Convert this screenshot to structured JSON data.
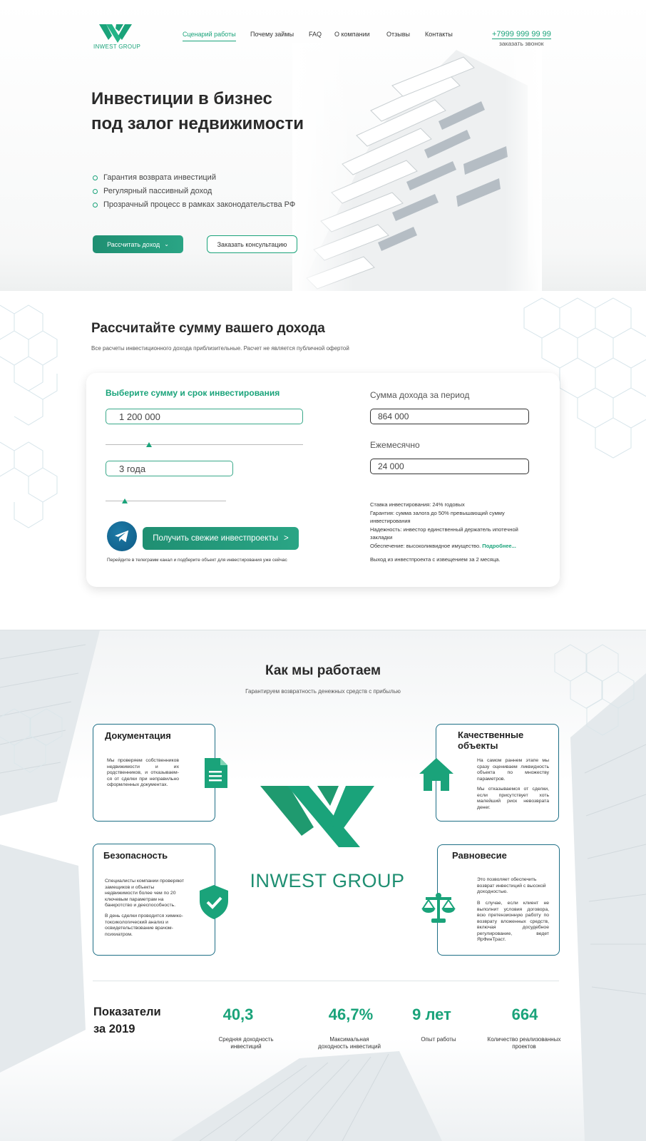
{
  "brand": {
    "name": "INWEST GROUP",
    "accent": "#1aa37a"
  },
  "nav": {
    "items": [
      "Сценарий работы",
      "Почему займы",
      "FAQ",
      "О компании",
      "Отзывы",
      "Контакты"
    ],
    "active": "Сценарий работы"
  },
  "contact": {
    "phone": "+7999 999 99 99",
    "callback": "заказать звонок"
  },
  "hero": {
    "title_line1": "Инвестиции в бизнес",
    "title_line2": "под залог недвижимости",
    "bullets": [
      "Гарантия возврата инвестиций",
      "Регулярный пассивный доход",
      "Прозрачный процесс в рамках законодательства РФ"
    ],
    "btn_calc": "Рассчитать доход",
    "btn_consult": "Заказать консультацию"
  },
  "calculator": {
    "title": "Рассчитайте сумму вашего дохода",
    "subtitle": "Все расчеты инвестиционного дохода приблизительные. Расчет не является публичной офертой",
    "left_heading": "Выберите сумму и срок инвестирования",
    "amount_value": "1 200 000",
    "amount_slider_fraction": 0.22,
    "term_value": "3 года",
    "term_slider_fraction": 0.16,
    "income_label": "Сумма дохода за период",
    "income_value": "864 000",
    "monthly_label": "Ежемесячно",
    "monthly_value": "24 000",
    "fresh_btn": "Получить свежие инвестпроекты",
    "fresh_btn_arrow": ">",
    "telegram_note": "Перейдите в телеграмм канал и подберите объект для инвестирования уже сейчас",
    "info": [
      "Ставка инвестирования: 24% годовых",
      "Гарантия: сумма залога до 50% превышающий сумму инвестирования",
      "Надежность: инвестор единственный держатель ипотечной закладки",
      "Обеспечение: высоколиквидное имущество."
    ],
    "info_more": "Подробнее...",
    "exit_note": "Выход из инвестпроекта с извещением за 2 месяца."
  },
  "how": {
    "title": "Как мы работаем",
    "subtitle": "Гарантируем возвратность денежных средств с прибылью",
    "cards": [
      {
        "title": "Документация",
        "text": "Мы проверяем собственников недвижимости и их родственников, и отказываем- ся от сделки при неправильно оформленных документах.",
        "icon": "document-icon"
      },
      {
        "title": "Качественные объекты",
        "text": "На самом раннем этапе мы сразу оцениваем ликвидность объекта по множеству параметров.",
        "text2": "Мы отказываемся от сделки, если присутствует хоть малейший риск невозврата денег.",
        "icon": "house-icon"
      },
      {
        "title": "Безопасность",
        "text": "Специалисты компании проверяют замещиков и объекты недвижимости более чем по 20 ключевым параметрам на банкротство и дееспособность.",
        "text2": "В день сделки проводится химико-токсикологический анализ и освидетельствование врачом- психиатром.",
        "icon": "shield-check-icon"
      },
      {
        "title": "Равновесие",
        "text": "Это позволяет обеспечить возврат инвестиций с высокой доходностью.",
        "text2": "В случае, если клиент не выполнит условия договора, всю претензионную работу по возврату вложенных средств, включая досудебное регулирование, ведет ЯрФинТраст.",
        "icon": "scales-icon"
      }
    ]
  },
  "stats": {
    "title_line1": "Показатели",
    "title_line2": "за 2019",
    "items": [
      {
        "value": "40,3",
        "label": "Средняя доходность инвестиций"
      },
      {
        "value": "46,7%",
        "label": "Максимальная доходность инвестиций"
      },
      {
        "value": "9 лет",
        "label": "Опыт работы"
      },
      {
        "value": "664",
        "label": "Количество реализованных проектов"
      }
    ]
  }
}
